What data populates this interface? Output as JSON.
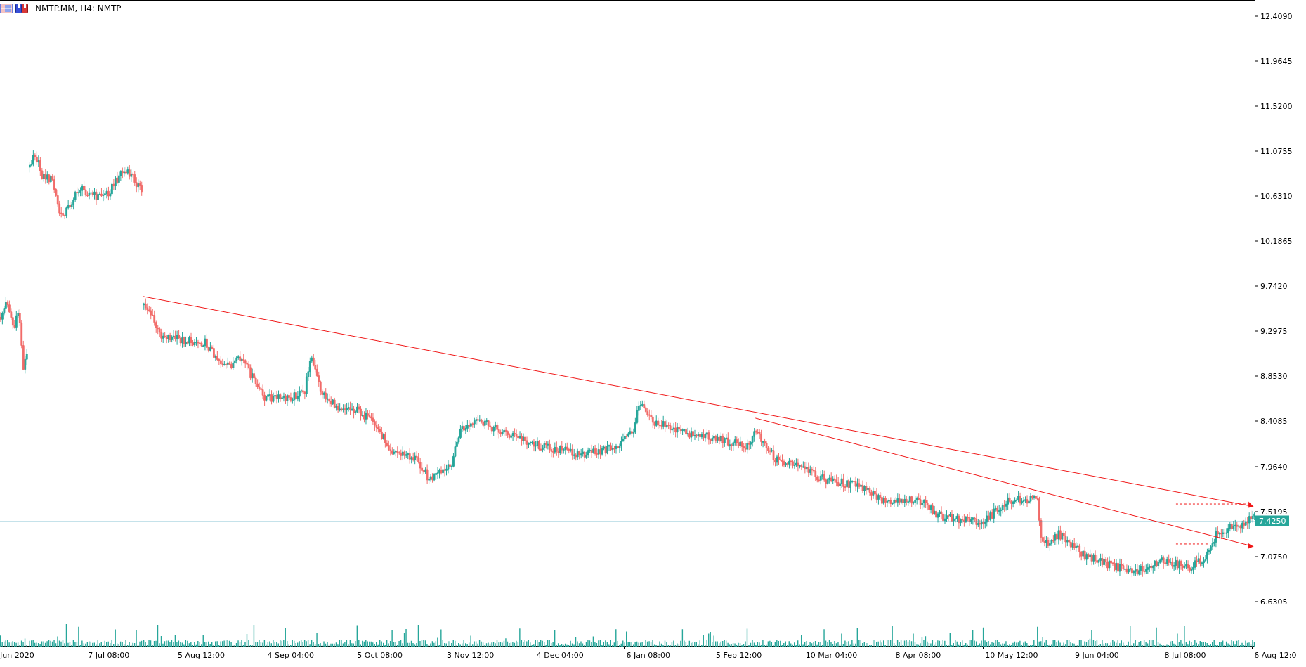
{
  "header": {
    "symbol_title": "NMTP.MM, H4: NMTP"
  },
  "price_axis": {
    "ticks": [
      "12.4090",
      "11.9645",
      "11.5200",
      "11.0755",
      "10.6310",
      "10.1865",
      "9.7420",
      "9.2975",
      "8.8530",
      "8.4085",
      "7.9640",
      "7.5195",
      "7.0750",
      "6.6305"
    ],
    "current_price": "7.4250"
  },
  "time_axis": {
    "ticks": [
      "Jun 2020",
      "7 Jul 08:00",
      "5 Aug 12:00",
      "4 Sep 04:00",
      "5 Oct 08:00",
      "3 Nov 12:00",
      "4 Dec 04:00",
      "6 Jan 08:00",
      "5 Feb 12:00",
      "10 Mar 04:00",
      "8 Apr 08:00",
      "10 May 12:00",
      "9 Jun 04:00",
      "8 Jul 08:00",
      "6 Aug 12:0"
    ]
  }
}
